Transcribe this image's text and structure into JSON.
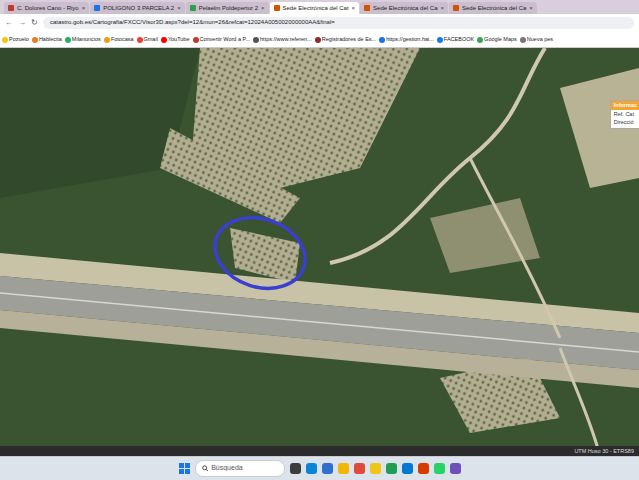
{
  "browser": {
    "tabs": [
      {
        "label": "C. Dolores Cano - Riyo",
        "selected": false,
        "color": "#c0392b"
      },
      {
        "label": "POLIGONO 3 PARCELA 2",
        "selected": false,
        "color": "#1a73e8"
      },
      {
        "label": "Pelaelm Poldepertur 2",
        "selected": false,
        "color": "#2e9e4f"
      },
      {
        "label": "Sede Electrónica del Cat",
        "selected": true,
        "color": "#d35400"
      },
      {
        "label": "Sede Electrónica del Ca",
        "selected": false,
        "color": "#d35400"
      },
      {
        "label": "Sede Electrónica del Ca",
        "selected": false,
        "color": "#d35400"
      }
    ],
    "tab_close": "×",
    "nav": [
      "←",
      "→",
      "↻"
    ],
    "address": "catastro.gob.es/Cartografia/FXCC/Visor3D.aspx?del=12&mun=26&refcat=12024A005002000000AA&final=",
    "bookmarks": [
      {
        "label": "Pozuelo",
        "color": "#f1c40f"
      },
      {
        "label": "Hablecita",
        "color": "#e67e22"
      },
      {
        "label": "Milanuncios",
        "color": "#27ae60"
      },
      {
        "label": "Fotocasa",
        "color": "#f39c12"
      },
      {
        "label": "Gmail",
        "color": "#ea4335"
      },
      {
        "label": "YouTube",
        "color": "#ff0000"
      },
      {
        "label": "Convertir Word a P...",
        "color": "#c0392b"
      },
      {
        "label": "https://www.referen...",
        "color": "#555555"
      },
      {
        "label": "Registradores de Es...",
        "color": "#8e2b2b"
      },
      {
        "label": "https://gestion.hai...",
        "color": "#1a73e8"
      },
      {
        "label": "FACEBOOK",
        "color": "#1877f2"
      },
      {
        "label": "Google Maps",
        "color": "#34a853"
      },
      {
        "label": "Nueva pes",
        "color": "#777777"
      }
    ]
  },
  "map": {
    "info_popup": {
      "title": "Informac",
      "lines": [
        "Ref. Cat",
        "Direcció"
      ]
    },
    "coordinates": "UTM Huso 30 - ETRS89"
  },
  "taskbar": {
    "search": {
      "placeholder": "Búsqueda"
    },
    "apps": [
      {
        "color": "#3d3d3d"
      },
      {
        "color": "#0a84d6"
      },
      {
        "color": "#2f6fd0"
      },
      {
        "color": "#f2b705"
      },
      {
        "color": "#e04a3a"
      },
      {
        "color": "#f0c419"
      },
      {
        "color": "#1f9d55"
      },
      {
        "color": "#0078d4"
      },
      {
        "color": "#d83b01"
      },
      {
        "color": "#25d366"
      },
      {
        "color": "#6b4fbb"
      }
    ]
  }
}
